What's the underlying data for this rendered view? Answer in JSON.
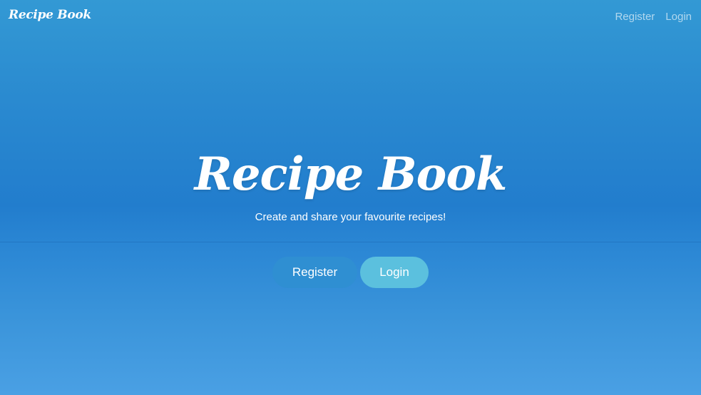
{
  "navbar": {
    "brand": "Recipe Book",
    "links": [
      {
        "label": "Register"
      },
      {
        "label": "Login"
      }
    ]
  },
  "hero": {
    "title": "Recipe Book",
    "subtitle": "Create and share your favourite recipes!",
    "buttons": [
      {
        "label": "Register",
        "color": "#2f8fd2"
      },
      {
        "label": "Login",
        "color": "#5bc0de"
      }
    ]
  },
  "colors": {
    "background_top": "#3399d4",
    "background_mid": "#227dcd",
    "background_bottom": "#4aa0e4",
    "text": "#ffffff"
  }
}
